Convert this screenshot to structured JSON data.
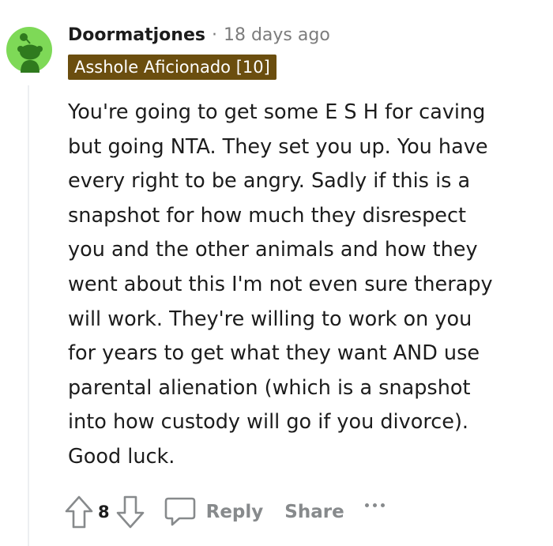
{
  "comment": {
    "avatar_icon": "reddit-snoo-avatar-icon",
    "avatar_color": "#7ed957",
    "username": "Doormatjones",
    "separator": "·",
    "timestamp": "18 days ago",
    "flair": {
      "text": "Asshole Aficionado [10]",
      "background": "#6b4e0f"
    },
    "body_lines": [
      "You're going to get some E S H for caving",
      "but going NTA. They set you up. You have",
      "every right to be angry. Sadly if this is a",
      "snapshot for how much they disrespect",
      "you and the other animals and how they",
      "went about this I'm not even sure therapy",
      "will work. They're willing to work on you",
      "for years to get what they want AND use",
      "parental alienation (which is a snapshot",
      "into how custody will go if you divorce).",
      "Good luck."
    ]
  },
  "actions": {
    "upvote_icon": "arrow-up-icon",
    "vote_count": "8",
    "downvote_icon": "arrow-down-icon",
    "reply_icon": "speech-bubble-icon",
    "reply_label": "Reply",
    "share_label": "Share",
    "more_icon": "more-horizontal-icon"
  }
}
